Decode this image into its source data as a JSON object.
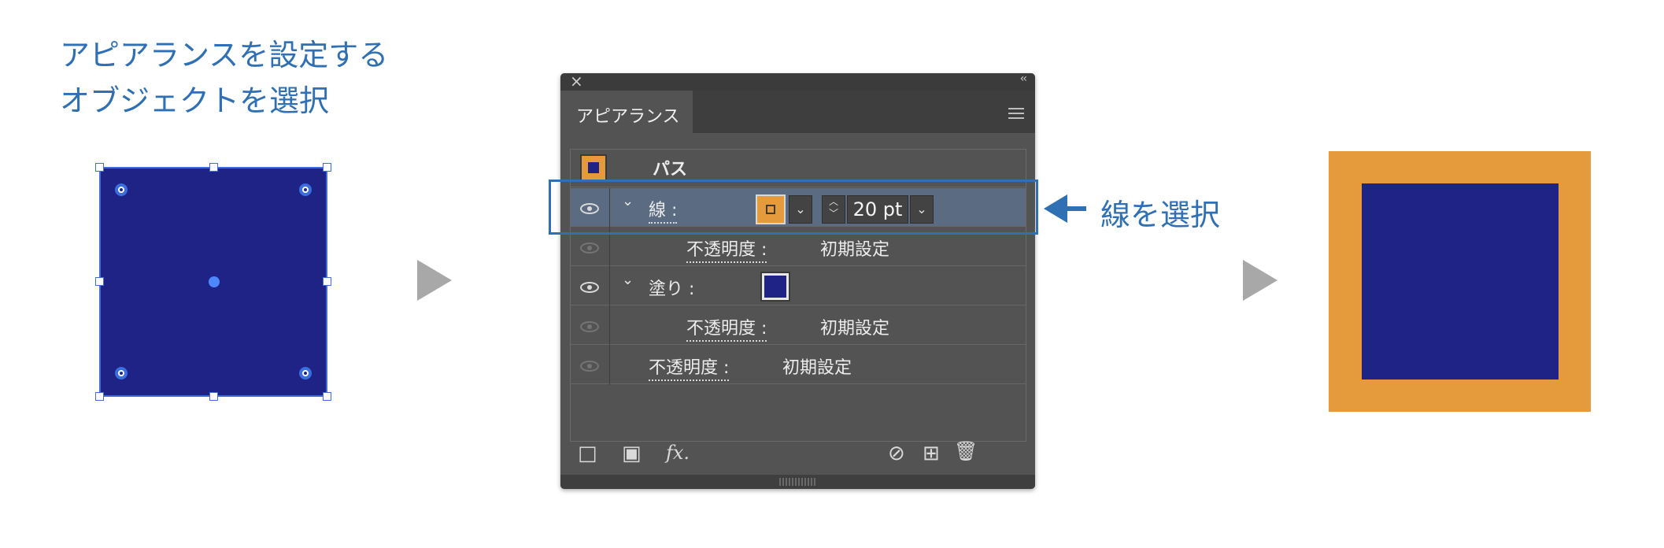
{
  "caption": {
    "line1": "アピアランスを設定する",
    "line2": "オブジェクトを選択"
  },
  "panel": {
    "close_glyph": "×",
    "collapse_glyph": "‹‹",
    "tab_label": "アピアランス",
    "menu_icon": "hamburger-menu-icon",
    "object_label": "パス",
    "rows": {
      "stroke_label": "線 :",
      "stroke_weight": "20 pt",
      "stroke_opacity_label": "不透明度 :",
      "stroke_opacity_value": "初期設定",
      "fill_label": "塗り :",
      "fill_opacity_label": "不透明度 :",
      "fill_opacity_value": "初期設定",
      "object_opacity_label": "不透明度 :",
      "object_opacity_value": "初期設定"
    },
    "bottom_icons": {
      "add_stroke": "□",
      "add_fill": "▣",
      "fx": "fx.",
      "clear": "⊘",
      "duplicate": "⊞",
      "delete": "🗑"
    },
    "glyphs": {
      "chevron": "⌄",
      "dropdown": "⌄",
      "stepper_up": "︿",
      "stepper_down": "﹀"
    }
  },
  "callout": {
    "text": "線を選択"
  },
  "colors": {
    "fill": "#1f2385",
    "stroke": "#e59a3b",
    "accent": "#2f6fb3",
    "panel_bg": "#535353",
    "selected_row": "#5b6b82"
  }
}
